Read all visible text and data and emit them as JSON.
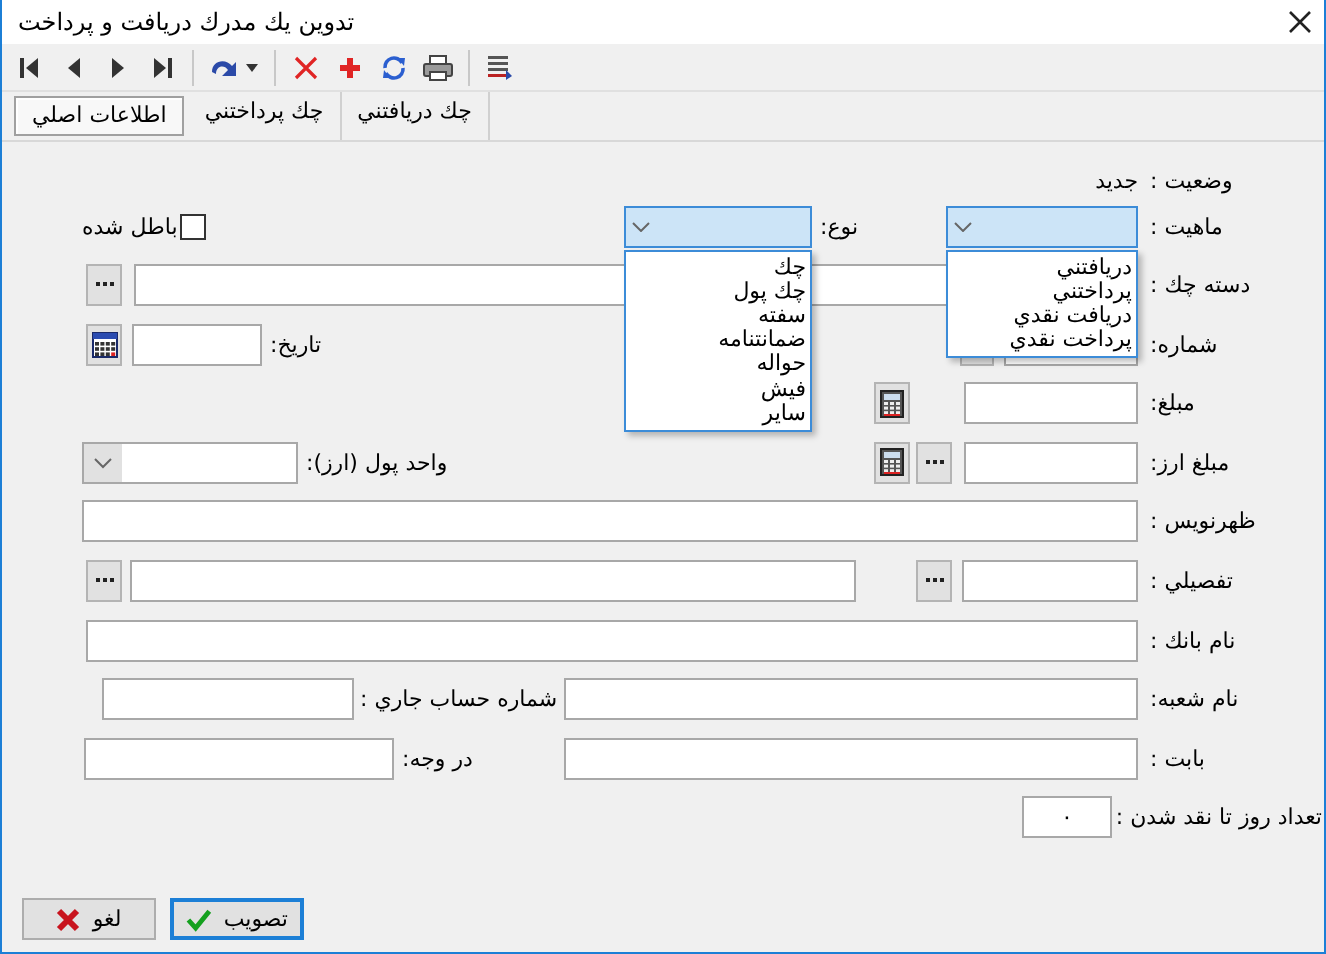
{
  "window": {
    "title": "تدوين يك مدرك دريافت و پرداخت"
  },
  "tabs": [
    {
      "label": "چك دريافتني",
      "selected": false
    },
    {
      "label": "چك پرداختني",
      "selected": false
    },
    {
      "label": "اطلاعات اصلي",
      "selected": true
    }
  ],
  "form": {
    "status": {
      "label": "وضعيت :",
      "value": "جديد"
    },
    "nature": {
      "label": "ماهيت :",
      "expanded": true,
      "options": [
        "دريافتني",
        "پرداختني",
        "دريافت نقدي",
        "پرداخت نقدي"
      ]
    },
    "type": {
      "label": "نوع:",
      "expanded": true,
      "options": [
        "چك",
        "چك پول",
        "سفته",
        "ضمانتنامه",
        "حواله",
        "فيش",
        "ساير"
      ]
    },
    "void": {
      "label": "باطل شده",
      "checked": false
    },
    "checkbook": {
      "label": "دسته چك :"
    },
    "number": {
      "label": "شماره:"
    },
    "date": {
      "label": "تاريخ:"
    },
    "amount": {
      "label": "مبلغ:"
    },
    "fx_amount": {
      "label": "مبلغ ارز:"
    },
    "currency": {
      "label": "واحد پول (ارز):"
    },
    "endorser": {
      "label": "ظهرنويس :"
    },
    "detail": {
      "label": "تفصيلي :"
    },
    "bank_name": {
      "label": "نام بانك :"
    },
    "branch_name": {
      "label": "نام شعبه:"
    },
    "account_number": {
      "label": "شماره حساب جاري :"
    },
    "purpose": {
      "label": "بابت :"
    },
    "payee": {
      "label": "در وجه:"
    },
    "days_to_cash": {
      "label": "تعداد روز تا نقد شدن :",
      "value": "۰"
    }
  },
  "buttons": [
    {
      "label": "تصويب",
      "kind": "approve"
    },
    {
      "label": "لغو",
      "kind": "cancel"
    }
  ]
}
